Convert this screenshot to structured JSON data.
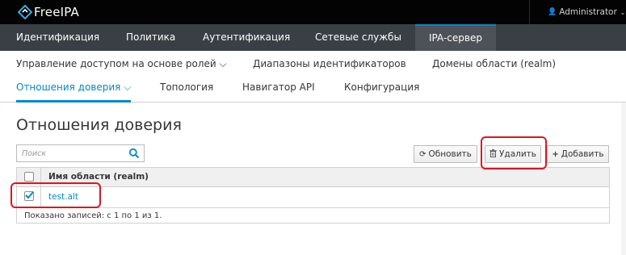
{
  "topbar": {
    "brand": "FreeIPA",
    "user_name": "Administrator"
  },
  "main_nav": {
    "items": [
      {
        "label": "Идентификация"
      },
      {
        "label": "Политика"
      },
      {
        "label": "Аутентификация"
      },
      {
        "label": "Сетевые службы"
      },
      {
        "label": "IPA-сервер",
        "active": true
      }
    ]
  },
  "sub_nav": {
    "row1": [
      {
        "label": "Управление доступом на основе ролей ⌵"
      },
      {
        "label": "Диапазоны идентификаторов"
      },
      {
        "label": "Домены области (realm)"
      }
    ],
    "row2": [
      {
        "label": "Отношения доверия ⌵",
        "active": true
      },
      {
        "label": "Топология"
      },
      {
        "label": "Навигатор API"
      },
      {
        "label": "Конфигурация"
      }
    ]
  },
  "page": {
    "title": "Отношения доверия"
  },
  "search": {
    "placeholder": "Поиск",
    "value": ""
  },
  "toolbar": {
    "refresh_label": "Обновить",
    "delete_label": "Удалить",
    "add_label": "Добавить"
  },
  "table": {
    "column_header": "Имя области (realm)",
    "rows": [
      {
        "realm": "test.alt",
        "checked": true
      }
    ],
    "footer": "Показано записей: с 1 по 1 из 1."
  },
  "colors": {
    "accent": "#0088ce",
    "topbar": "#030303",
    "main_nav": "#393f44",
    "main_nav_active": "#4d5258",
    "highlight": "#e0141e"
  }
}
